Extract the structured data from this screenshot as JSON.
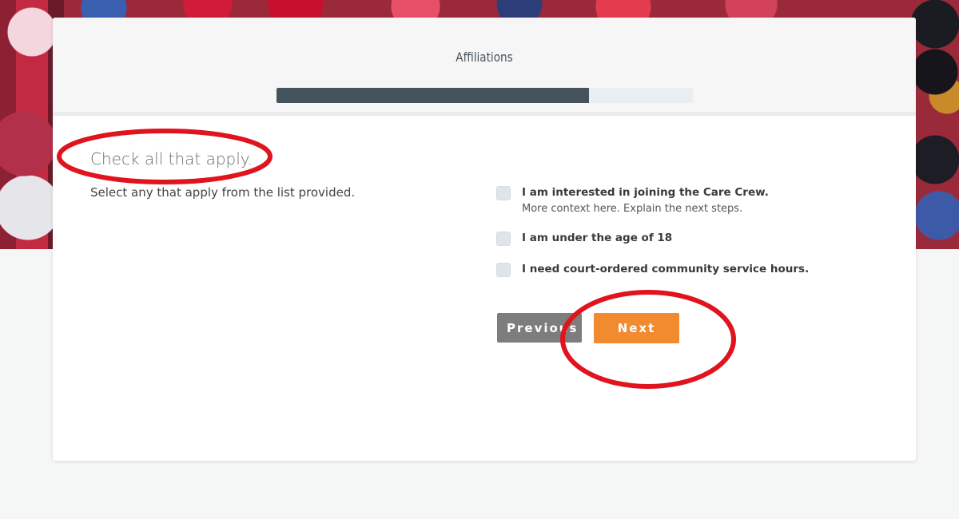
{
  "step": {
    "title": "Affiliations",
    "progress_percent": 75
  },
  "section": {
    "title": "Check all that apply.",
    "subtitle": "Select any that apply from the list provided."
  },
  "options": [
    {
      "label": "I am interested in joining the Care Crew.",
      "description": "More context here. Explain the next steps.",
      "checked": false
    },
    {
      "label": "I am under the age of 18",
      "checked": false
    },
    {
      "label": "I need court-ordered community service hours.",
      "checked": false
    }
  ],
  "buttons": {
    "previous_label": "Previous",
    "next_label": "Next"
  },
  "colors": {
    "progress_fill": "#45535c",
    "next_button": "#f28a30",
    "previous_button": "#7d7d7d",
    "annotation": "#e0141e"
  }
}
